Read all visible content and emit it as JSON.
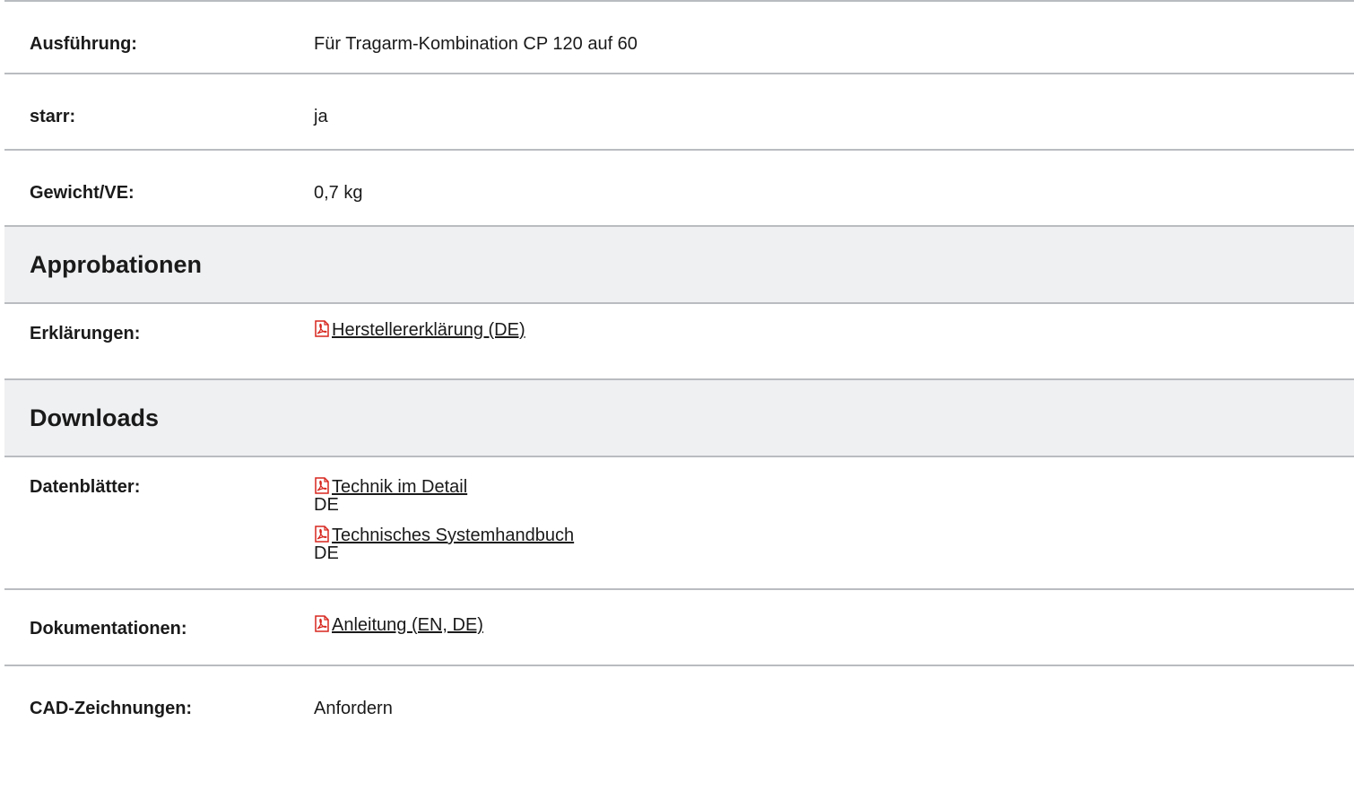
{
  "colors": {
    "section_bg": "#eff0f2",
    "divider": "#b9bcc0",
    "pdf_icon": "#d7261e"
  },
  "rows_top": [
    {
      "label": "Ausführung:",
      "value": "Für Tragarm-Kombination CP 120 auf 60"
    },
    {
      "label": "starr:",
      "value": "ja"
    },
    {
      "label": "Gewicht/VE:",
      "value": "0,7 kg"
    }
  ],
  "approbationen": {
    "heading": "Approbationen",
    "erklaerungen": {
      "label": "Erklärungen:",
      "link": "Herstellererklärung (DE)",
      "icon": "pdf-icon"
    }
  },
  "downloads": {
    "heading": "Downloads",
    "datenblaetter": {
      "label": "Datenblätter:",
      "items": [
        {
          "link": "Technik im Detail",
          "lang": "DE",
          "icon": "pdf-icon"
        },
        {
          "link": "Technisches Systemhandbuch",
          "lang": "DE",
          "icon": "pdf-icon"
        }
      ]
    },
    "dokumentationen": {
      "label": "Dokumentationen:",
      "link": "Anleitung (EN, DE)",
      "icon": "pdf-icon"
    },
    "cad": {
      "label": "CAD-Zeichnungen:",
      "value": "Anfordern"
    }
  }
}
